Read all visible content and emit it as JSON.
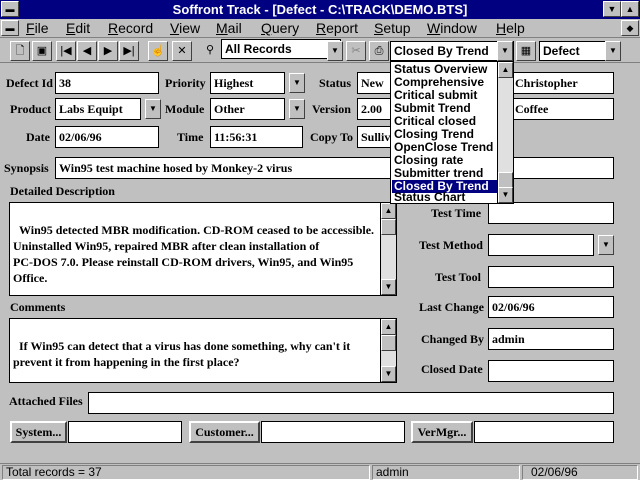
{
  "window": {
    "title": "Soffront Track - [Defect - C:\\TRACK\\DEMO.BTS]"
  },
  "menu": {
    "items": [
      {
        "label": "File",
        "u": "F",
        "rest": "ile"
      },
      {
        "label": "Edit",
        "u": "E",
        "rest": "dit"
      },
      {
        "label": "Record",
        "u": "R",
        "rest": "ecord"
      },
      {
        "label": "View",
        "u": "V",
        "rest": "iew"
      },
      {
        "label": "Mail",
        "u": "M",
        "rest": "ail"
      },
      {
        "label": "Query",
        "u": "Q",
        "rest": "uery"
      },
      {
        "label": "Report",
        "u": "R",
        "rest": "eport"
      },
      {
        "label": "Setup",
        "u": "S",
        "rest": "etup"
      },
      {
        "label": "Window",
        "u": "W",
        "rest": "indow"
      },
      {
        "label": "Help",
        "u": "H",
        "rest": "elp"
      }
    ]
  },
  "toolbar": {
    "records_filter": "All Records",
    "report_select": "Closed By Trend",
    "form_select": "Defect"
  },
  "report_list": {
    "options": [
      "Status Overview",
      "Comprehensive",
      "Critical submit",
      "Submit Trend",
      "Critical closed",
      "Closing Trend",
      "OpenClose Trend",
      "Closing rate",
      "Submitter trend",
      "Closed By Trend",
      "Status Chart"
    ],
    "selected_index": 9
  },
  "form": {
    "defect_id": {
      "label": "Defect Id",
      "value": "38"
    },
    "priority": {
      "label": "Priority",
      "value": "Highest"
    },
    "status": {
      "label": "Status",
      "value": "New"
    },
    "assigned_to": {
      "value": "Christopher"
    },
    "product": {
      "label": "Product",
      "value": "Labs Equipt"
    },
    "module": {
      "label": "Module",
      "value": "Other"
    },
    "version": {
      "label": "Version",
      "value": "2.00"
    },
    "found_in": {
      "value": "Coffee"
    },
    "date": {
      "label": "Date",
      "value": "02/06/96"
    },
    "time": {
      "label": "Time",
      "value": "11:56:31"
    },
    "copy_to": {
      "label": "Copy To",
      "value": "Sullivan"
    },
    "synopsis": {
      "label": "Synopsis",
      "value": "Win95 test machine hosed by Monkey-2 virus"
    },
    "detailed_description": {
      "label": "Detailed Description",
      "value": "Win95 detected MBR modification. CD-ROM ceased to be accessible.\nUninstalled Win95, repaired MBR after clean installation of\nPC-DOS 7.0. Please reinstall CD-ROM drivers, Win95, and Win95\nOffice."
    },
    "comments": {
      "label": "Comments",
      "value": "If Win95 can detect that a virus has done something, why can't it\nprevent it from happening in the first place?"
    },
    "test_time": {
      "label": "Test Time",
      "value": ""
    },
    "test_method": {
      "label": "Test Method",
      "value": ""
    },
    "test_tool": {
      "label": "Test Tool",
      "value": ""
    },
    "last_change": {
      "label": "Last Change",
      "value": "02/06/96"
    },
    "changed_by": {
      "label": "Changed By",
      "value": "admin"
    },
    "closed_date": {
      "label": "Closed Date",
      "value": ""
    },
    "attached_files": {
      "label": "Attached Files",
      "value": ""
    },
    "buttons": {
      "system": "System...",
      "customer": "Customer...",
      "vermgr": "VerMgr..."
    }
  },
  "status_bar": {
    "total_records": "Total records = 37",
    "user": "admin",
    "date": "02/06/96"
  }
}
